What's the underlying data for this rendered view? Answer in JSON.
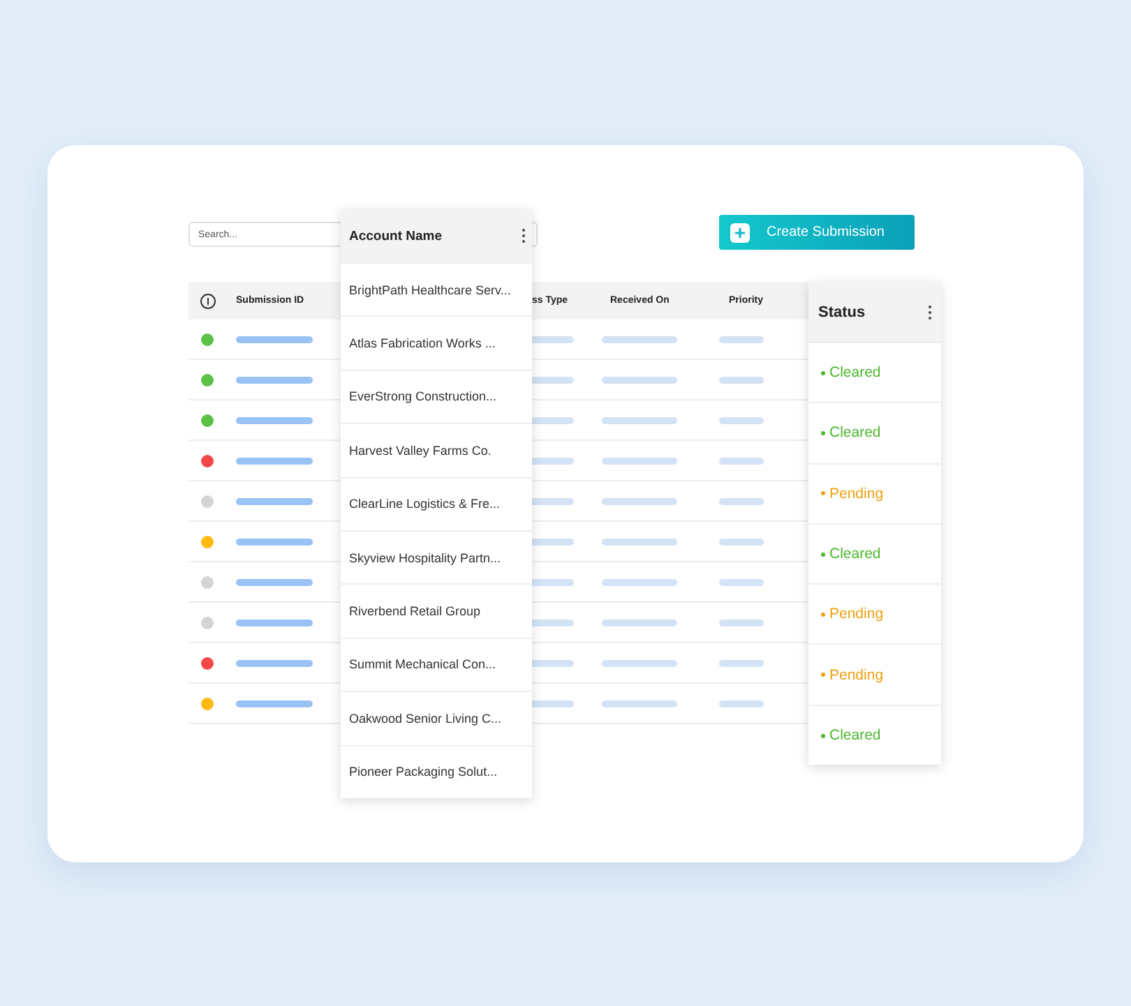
{
  "search": {
    "placeholder": "Search..."
  },
  "create_button": {
    "label": "Create Submission"
  },
  "table": {
    "columns": [
      "Submission ID",
      "ss Type",
      "Received On",
      "Priority"
    ],
    "rows": [
      {
        "color": "#5cc246"
      },
      {
        "color": "#5cc246"
      },
      {
        "color": "#5cc246"
      },
      {
        "color": "#f44848"
      },
      {
        "color": "#d4d4d4"
      },
      {
        "color": "#ffbb12"
      },
      {
        "color": "#d4d4d4"
      },
      {
        "color": "#d4d4d4"
      },
      {
        "color": "#f44848"
      },
      {
        "color": "#ffbb12"
      }
    ]
  },
  "account_panel": {
    "title": "Account Name",
    "items": [
      "BrightPath Healthcare Serv...",
      "Atlas Fabrication Works ...",
      "EverStrong Construction...",
      "Harvest Valley Farms Co.",
      "ClearLine Logistics & Fre...",
      "Skyview Hospitality Partn...",
      "Riverbend Retail Group",
      "Summit Mechanical Con...",
      "Oakwood Senior Living C...",
      "Pioneer Packaging Solut..."
    ]
  },
  "status_panel": {
    "title": "Status",
    "items": [
      {
        "label": "Cleared",
        "kind": "cleared"
      },
      {
        "label": "Cleared",
        "kind": "cleared"
      },
      {
        "label": "Pending",
        "kind": "pending"
      },
      {
        "label": "Cleared",
        "kind": "cleared"
      },
      {
        "label": "Pending",
        "kind": "pending"
      },
      {
        "label": "Pending",
        "kind": "pending"
      },
      {
        "label": "Cleared",
        "kind": "cleared"
      }
    ]
  }
}
